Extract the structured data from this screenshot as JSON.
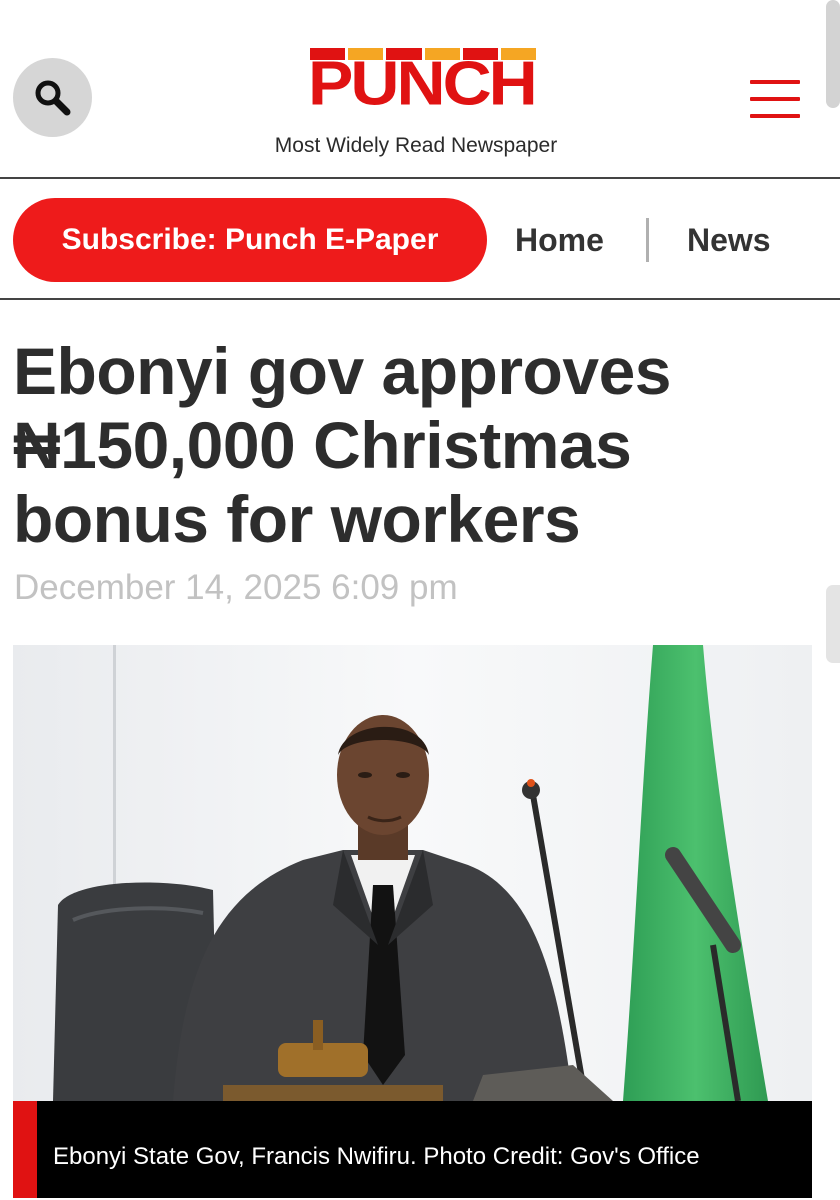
{
  "header": {
    "logo_text": "PUNCH",
    "tagline": "Most Widely Read Newspaper",
    "search_icon": "search-icon",
    "menu_icon": "hamburger-menu-icon",
    "logo_bar_colors": [
      "#e01212",
      "#f5a623",
      "#e01212",
      "#f5a623",
      "#e01212",
      "#f5a623"
    ]
  },
  "nav": {
    "subscribe_label": "Subscribe: Punch E-Paper",
    "items": [
      {
        "label": "Home"
      },
      {
        "label": "News"
      }
    ]
  },
  "article": {
    "headline": "Ebonyi gov approves ₦150,000 Christmas bonus for workers",
    "date": "December 14, 2025 6:09 pm",
    "image_caption": "Ebonyi State Gov, Francis Nwifiru. Photo Credit: Gov's Office"
  },
  "colors": {
    "brand_red": "#e01212",
    "subscribe_red": "#ee1b1b",
    "text_dark": "#2d2d2d",
    "date_gray": "#c2c2c2"
  }
}
